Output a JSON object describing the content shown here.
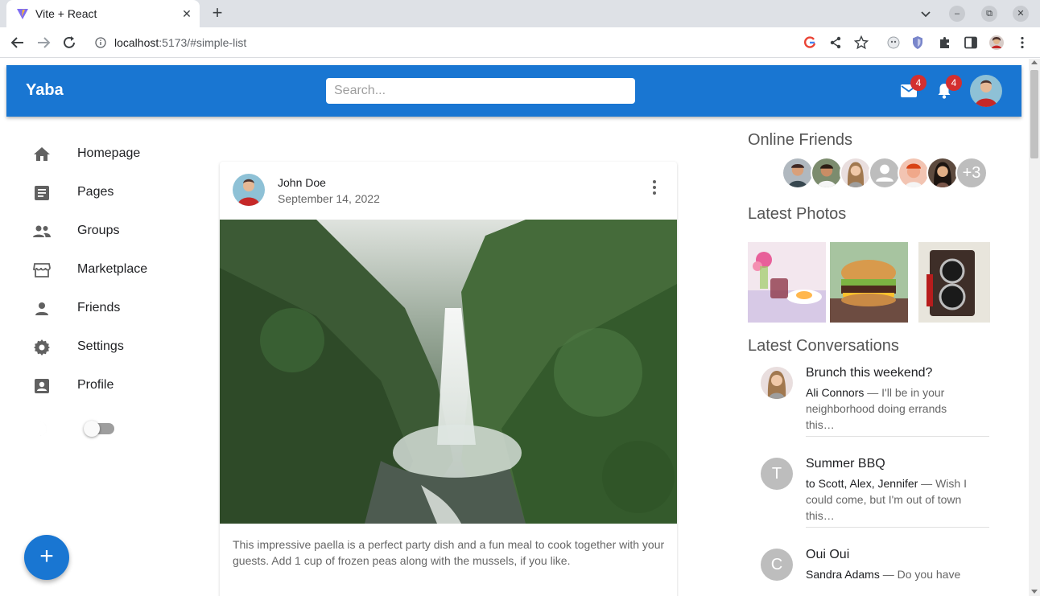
{
  "browser": {
    "tab_title": "Vite + React",
    "url_host": "localhost",
    "url_rest": ":5173/#simple-list"
  },
  "app": {
    "brand": "Yaba",
    "search_placeholder": "Search...",
    "mail_badge": "4",
    "notifications_badge": "4",
    "accent": "#1976d2",
    "badge_color": "#d32f2f"
  },
  "sidebar": {
    "items": [
      {
        "label": "Homepage",
        "icon": "home-icon"
      },
      {
        "label": "Pages",
        "icon": "article-icon"
      },
      {
        "label": "Groups",
        "icon": "group-icon"
      },
      {
        "label": "Marketplace",
        "icon": "storefront-icon"
      },
      {
        "label": "Friends",
        "icon": "person-icon"
      },
      {
        "label": "Settings",
        "icon": "gear-icon"
      },
      {
        "label": "Profile",
        "icon": "account-box-icon"
      }
    ],
    "dark_mode_icon": "moon-icon",
    "dark_mode_on": false
  },
  "post": {
    "author": "John Doe",
    "date": "September 14, 2022",
    "body": "This impressive paella is a perfect party dish and a fun meal to cook together with your guests. Add 1 cup of frozen peas along with the mussels, if you like."
  },
  "right": {
    "online_title": "Online Friends",
    "more_friends": "+3",
    "photos_title": "Latest Photos",
    "conversations_title": "Latest Conversations",
    "conversations": [
      {
        "title": "Brunch this weekend?",
        "who": "Ali Connors",
        "text": " — I'll be in your neighborhood doing errands this…",
        "avatar": "photo"
      },
      {
        "title": "Summer BBQ",
        "who": "to Scott, Alex, Jennifer",
        "text": " — Wish I could come, but I'm out of town this…",
        "avatar": "T"
      },
      {
        "title": "Oui Oui",
        "who": "Sandra Adams",
        "text": " — Do you have",
        "avatar": "C"
      }
    ]
  }
}
